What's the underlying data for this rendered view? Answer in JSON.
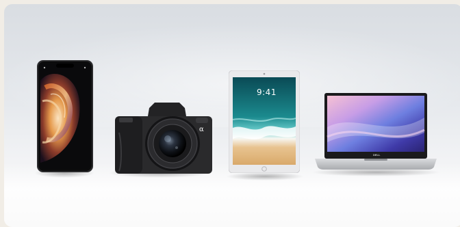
{
  "image": {
    "description_items": [
      "phone-device",
      "camera-device",
      "tablet-device",
      "laptop-device"
    ],
    "tablet": {
      "clock": "9:41"
    },
    "camera": {
      "mark": "α"
    },
    "laptop": {
      "logo": "DELL"
    },
    "colors": {
      "background": "#e6e9ed",
      "device_black": "#1c1c1e",
      "tablet_silver": "#e8e8ea",
      "laptop_silver": "#cfd1d4"
    }
  }
}
